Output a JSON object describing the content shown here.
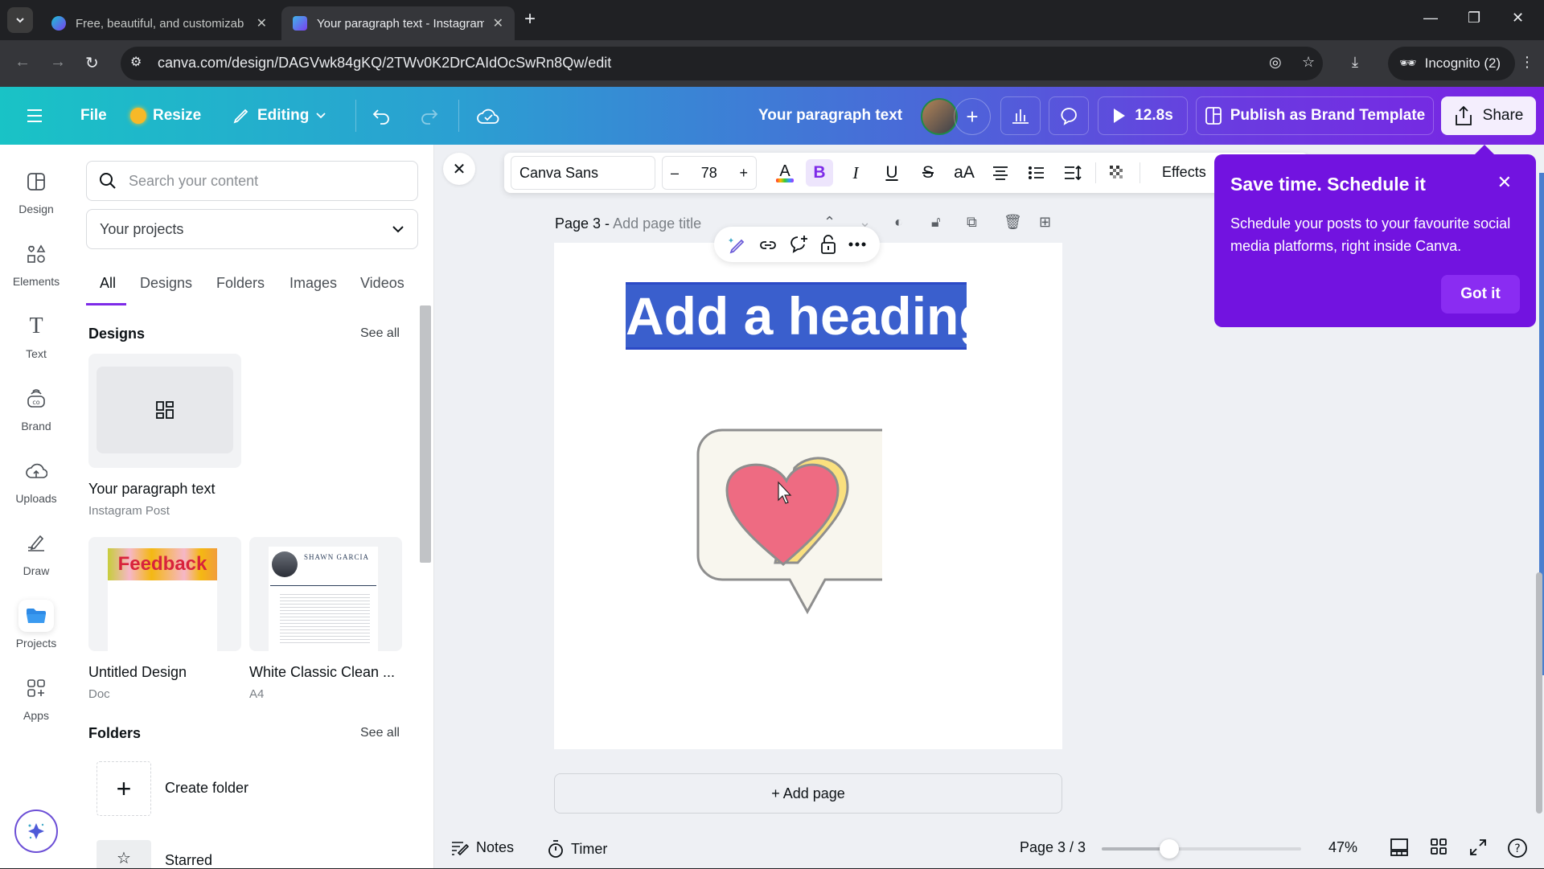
{
  "browser": {
    "tabs": [
      {
        "title": "Free, beautiful, and customizab",
        "favicon": "canva-logo-icon",
        "active": false
      },
      {
        "title": "Your paragraph text - Instagram",
        "favicon": "heart-favicon-icon",
        "active": true
      }
    ],
    "new_tab": "+",
    "window_controls": [
      "minimize",
      "restore",
      "close"
    ],
    "url": "canva.com/design/DAGVwk84gKQ/2TWv0K2DrCAIdOcSwRn8Qw/edit",
    "incognito_label": "Incognito (2)"
  },
  "header": {
    "file_label": "File",
    "resize_label": "Resize",
    "editing_label": "Editing",
    "design_title": "Your paragraph text",
    "timer_label": "12.8s",
    "publish_label": "Publish as Brand Template",
    "share_label": "Share"
  },
  "rail": {
    "items": [
      {
        "label": "Design",
        "icon": "layout-icon"
      },
      {
        "label": "Elements",
        "icon": "shapes-icon"
      },
      {
        "label": "Text",
        "icon": "text-icon"
      },
      {
        "label": "Brand",
        "icon": "brand-icon"
      },
      {
        "label": "Uploads",
        "icon": "cloud-upload-icon"
      },
      {
        "label": "Draw",
        "icon": "pen-icon"
      },
      {
        "label": "Projects",
        "icon": "folder-icon",
        "active": true
      },
      {
        "label": "Apps",
        "icon": "apps-icon"
      }
    ]
  },
  "panel": {
    "search_placeholder": "Search your content",
    "project_select": "Your projects",
    "tabs": [
      "All",
      "Designs",
      "Folders",
      "Images",
      "Videos"
    ],
    "active_tab": "All",
    "designs_heading": "Designs",
    "see_all": "See all",
    "designs": [
      {
        "name": "Your paragraph text",
        "type": "Instagram Post"
      },
      {
        "name": "Untitled Design",
        "type": "Doc",
        "thumb_text": "Feedback"
      },
      {
        "name": "White Classic Clean ...",
        "type": "A4",
        "thumb_text": "SHAWN GARCIA"
      }
    ],
    "folders_heading": "Folders",
    "folders": [
      {
        "name": "Create folder",
        "icon": "plus-icon"
      },
      {
        "name": "Starred",
        "icon": "star-icon"
      }
    ]
  },
  "toolbar": {
    "font": "Canva Sans",
    "size_minus": "–",
    "font_size": "78",
    "size_plus": "+",
    "bold": "B",
    "italic": "I",
    "underline": "U",
    "strike": "S",
    "case": "aA",
    "effects_label": "Effects"
  },
  "page": {
    "label": "Page 3 -",
    "title_placeholder": "Add page title",
    "heading_text": "Add a heading",
    "add_page_label": "+ Add page"
  },
  "popover": {
    "title": "Save time. Schedule it",
    "body": "Schedule your posts to your favourite social media platforms, right inside Canva.",
    "button": "Got it"
  },
  "footer": {
    "notes_label": "Notes",
    "timer_label": "Timer",
    "page_indicator": "Page 3 / 3",
    "zoom_percent": "47%",
    "zoom_fraction": 0.34
  },
  "colors": {
    "accent": "#7d2ae8",
    "popover_bg": "#7213e0",
    "selection": "#3a5fcd",
    "heart_pink": "#ee6b82",
    "heart_yellow": "#fae07e"
  }
}
